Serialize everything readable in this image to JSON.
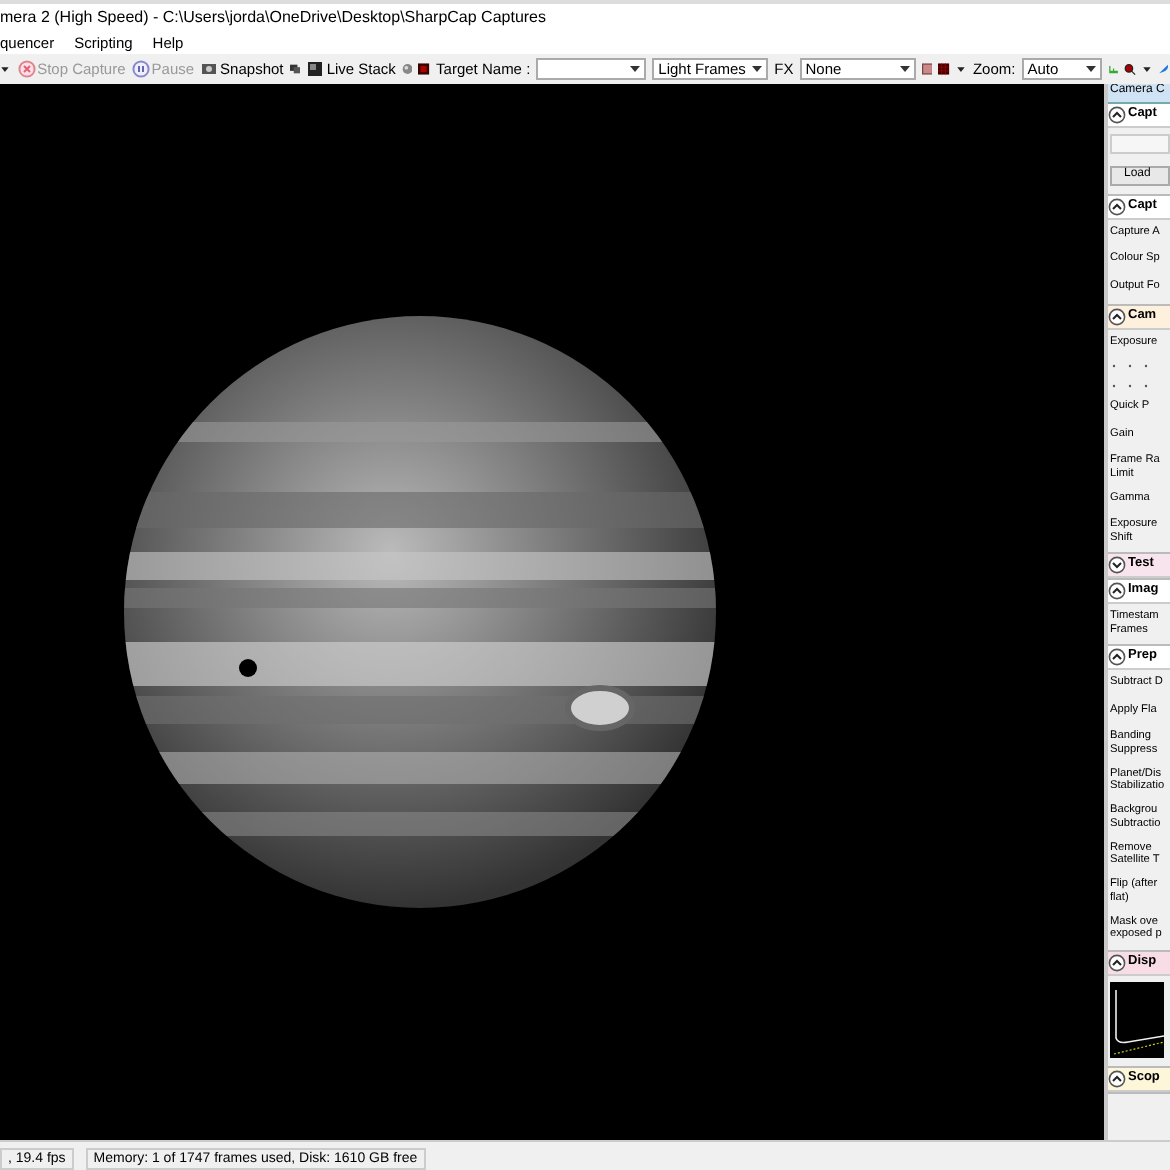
{
  "window": {
    "title": "mera 2 (High Speed) - C:\\Users\\jorda\\OneDrive\\Desktop\\SharpCap Captures"
  },
  "menu": [
    "quencer",
    "Scripting",
    "Help"
  ],
  "toolbar": {
    "stop_capture": {
      "label": "Stop Capture",
      "disabled": true
    },
    "pause": {
      "label": "Pause",
      "disabled": true
    },
    "snapshot": {
      "label": "Snapshot",
      "disabled": false
    },
    "live_stack": {
      "label": "Live Stack",
      "disabled": false
    },
    "target_name": {
      "label": "Target Name :"
    },
    "frame_type": {
      "value": "Light Frames"
    },
    "fx": {
      "label": "FX",
      "value": "None"
    },
    "zoom": {
      "label": "Zoom:",
      "value": "Auto"
    }
  },
  "side_panel": {
    "tab": "Camera C",
    "sections": [
      {
        "title": "Capt",
        "expanded": true,
        "color": "#ffffff",
        "rows": [
          {
            "kind": "field"
          },
          {
            "kind": "button",
            "label": "Load"
          }
        ]
      },
      {
        "title": "Capt",
        "expanded": true,
        "color": "#ffffff",
        "rows": [
          {
            "kind": "label",
            "label": "Capture A"
          },
          {
            "kind": "label",
            "label": "Colour Sp"
          },
          {
            "kind": "label",
            "label": "Output Fo"
          }
        ]
      },
      {
        "title": "Cam",
        "expanded": true,
        "color": "#fdf0dc",
        "rows": [
          {
            "kind": "label",
            "label": "Exposure"
          },
          {
            "kind": "ticks"
          },
          {
            "kind": "ticks"
          },
          {
            "kind": "label",
            "label": "Quick P"
          },
          {
            "kind": "label",
            "label": "Gain"
          },
          {
            "kind": "label",
            "label": "Frame Ra\nLimit"
          },
          {
            "kind": "label",
            "label": "Gamma"
          },
          {
            "kind": "label",
            "label": "Exposure\nShift"
          }
        ]
      },
      {
        "title": "Test",
        "expanded": false,
        "color": "#f8e4ec"
      },
      {
        "title": "Imag",
        "expanded": true,
        "color": "#ffffff",
        "rows": [
          {
            "kind": "label",
            "label": "Timestam\nFrames"
          }
        ]
      },
      {
        "title": "Prep",
        "expanded": true,
        "color": "#ffffff",
        "rows": [
          {
            "kind": "label",
            "label": "Subtract D"
          },
          {
            "kind": "label",
            "label": "Apply Fla"
          },
          {
            "kind": "label",
            "label": "Banding\nSuppress"
          },
          {
            "kind": "label",
            "label": "Planet/Dis\nStabilizatio"
          },
          {
            "kind": "label",
            "label": "Backgrou\nSubtractio"
          },
          {
            "kind": "label",
            "label": "Remove\nSatellite T"
          },
          {
            "kind": "label",
            "label": "Flip (after\nflat)"
          },
          {
            "kind": "label",
            "label": "Mask ove\nexposed p"
          }
        ]
      },
      {
        "title": "Disp",
        "expanded": true,
        "color": "#f8dde6",
        "rows": [
          {
            "kind": "histogram"
          }
        ]
      },
      {
        "title": "Scop",
        "expanded": true,
        "color": "#fdf6d8"
      }
    ]
  },
  "status_bar": [
    ", 19.4 fps",
    "Memory: 1 of 1747 frames used, Disk: 1610 GB free"
  ]
}
